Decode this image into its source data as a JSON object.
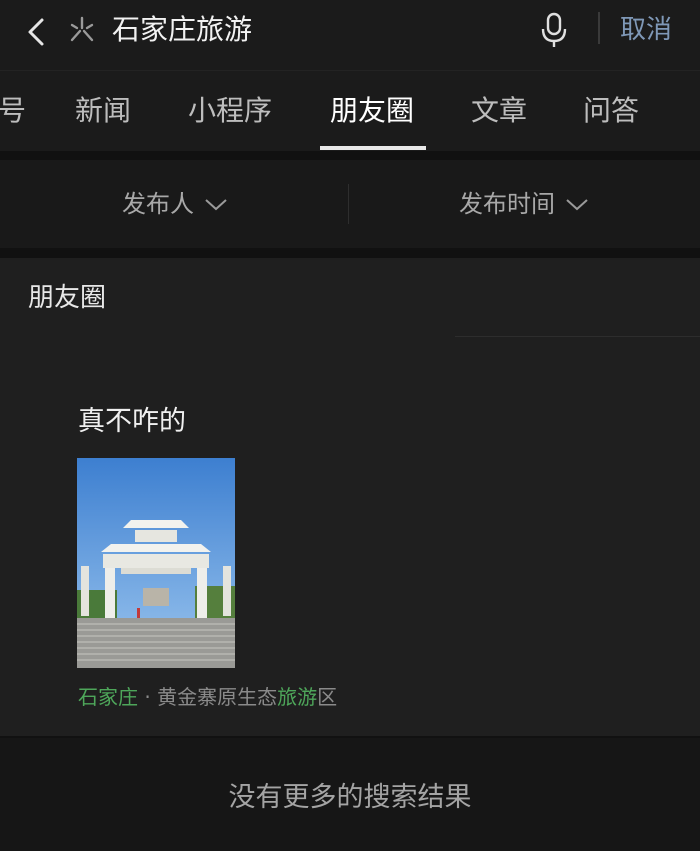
{
  "search": {
    "query": "石家庄旅游",
    "cancel_label": "取消"
  },
  "tabs": [
    {
      "label": "号"
    },
    {
      "label": "新闻"
    },
    {
      "label": "小程序"
    },
    {
      "label": "朋友圈"
    },
    {
      "label": "文章"
    },
    {
      "label": "问答"
    }
  ],
  "filters": {
    "publisher": "发布人",
    "publish_time": "发布时间"
  },
  "section": {
    "title": "朋友圈",
    "post": {
      "text": "真不咋的",
      "location_parts": [
        {
          "text": "石家庄",
          "highlight": true
        },
        {
          "text": " · 黄金寨原生态",
          "highlight": false
        },
        {
          "text": "旅游",
          "highlight": true
        },
        {
          "text": "区",
          "highlight": false
        }
      ]
    }
  },
  "footer": {
    "no_more": "没有更多的搜索结果"
  },
  "colors": {
    "accent_link": "#7f98b7",
    "highlight_green": "#4ea65a"
  }
}
